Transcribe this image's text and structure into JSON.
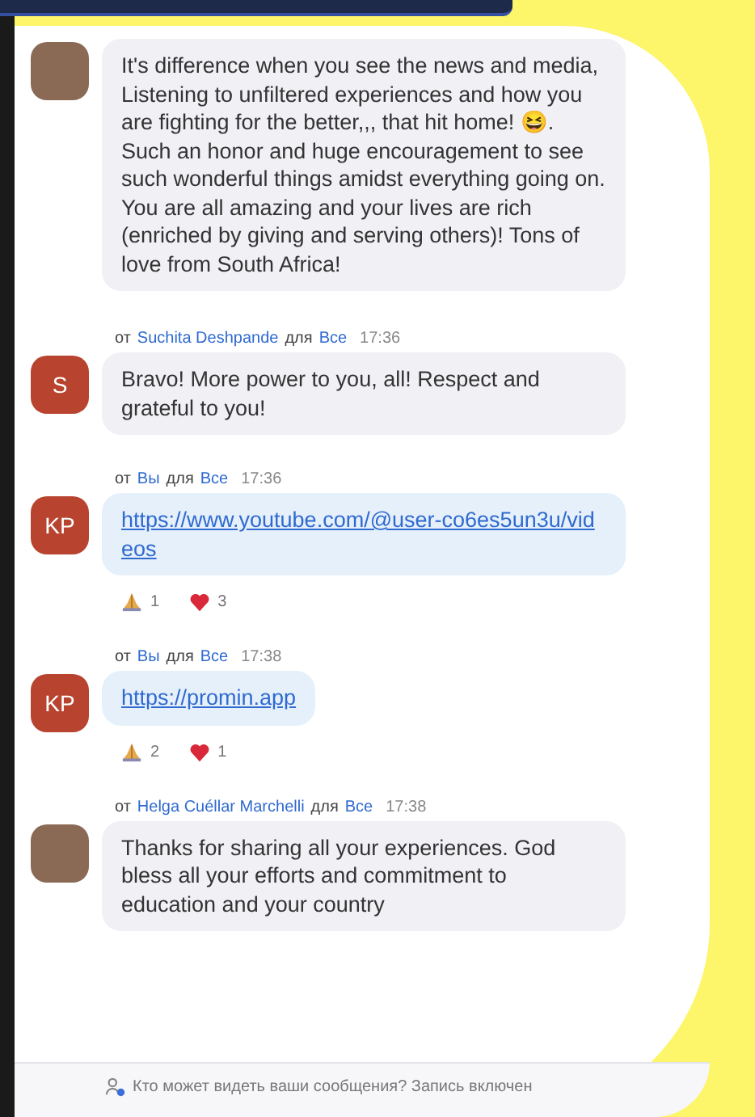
{
  "messages": [
    {
      "avatar": {
        "kind": "photo"
      },
      "kind": "text",
      "text": "It's difference when you see the news and media, Listening to unfiltered experiences and how you are fighting for the better,,, that hit home! 😆. Such an honor and huge encouragement to see such wonderful things amidst everything going on. You are all amazing and your lives are rich (enriched by giving and serving others)! Tons of love from South Africa!"
    },
    {
      "avatar": {
        "kind": "initials",
        "initials": "S"
      },
      "header": {
        "from_label": "от",
        "sender": "Suchita Deshpande",
        "to_label": "для",
        "recipient": "Все",
        "time": "17:36"
      },
      "kind": "text",
      "text": "Bravo! More power to you, all! Respect and grateful to you!"
    },
    {
      "avatar": {
        "kind": "initials",
        "initials": "KP"
      },
      "header": {
        "from_label": "от",
        "sender": "Вы",
        "to_label": "для",
        "recipient": "Все",
        "time": "17:36"
      },
      "kind": "link",
      "text": "https://www.youtube.com/@user-co6es5un3u/videos",
      "reactions": [
        {
          "kind": "pray",
          "count": "1"
        },
        {
          "kind": "heart",
          "count": "3"
        }
      ]
    },
    {
      "avatar": {
        "kind": "initials",
        "initials": "KP"
      },
      "header": {
        "from_label": "от",
        "sender": "Вы",
        "to_label": "для",
        "recipient": "Все",
        "time": "17:38"
      },
      "kind": "link",
      "text": "https://promin.app",
      "reactions": [
        {
          "kind": "pray",
          "count": "2"
        },
        {
          "kind": "heart",
          "count": "1"
        }
      ]
    },
    {
      "avatar": {
        "kind": "photo"
      },
      "header": {
        "from_label": "от",
        "sender": "Helga Cuéllar Marchelli",
        "to_label": "для",
        "recipient": "Все",
        "time": "17:38"
      },
      "kind": "text",
      "text": "Thanks for sharing all your experiences. God bless all your efforts and commitment to education and your country"
    }
  ],
  "footer": {
    "text": "Кто может видеть ваши сообщения? Запись включен"
  }
}
